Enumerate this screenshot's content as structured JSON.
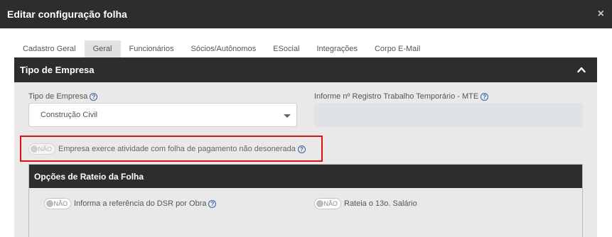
{
  "dialog": {
    "title": "Editar configuração folha",
    "close_glyph": "×"
  },
  "tabs": [
    {
      "label": "Cadastro Geral"
    },
    {
      "label": "Geral"
    },
    {
      "label": "Funcionários"
    },
    {
      "label": "Sócios/Autônomos"
    },
    {
      "label": "ESocial"
    },
    {
      "label": "Integrações"
    },
    {
      "label": "Corpo E-Mail"
    }
  ],
  "active_tab": "Geral",
  "section": {
    "title": "Tipo de Empresa",
    "tipo_empresa": {
      "label": "Tipo de Empresa",
      "value": "Construção Civil"
    },
    "registro": {
      "label": "Informe nº Registro Trabalho Temporário - MTE",
      "value": ""
    },
    "folha_toggle": {
      "state_label": "NÃO",
      "text": "Empresa exerce atividade com folha de pagamento não desonerada"
    },
    "rateio": {
      "title": "Opções de Rateio da Folha",
      "dsr": {
        "state_label": "NÃO",
        "text": "Informa a referência do DSR por Obra"
      },
      "salario13": {
        "state_label": "NÃO",
        "text": "Rateia o 13o. Salário"
      }
    }
  },
  "help_glyph": "?",
  "colors": {
    "header_bg": "#2d2d2d",
    "panel_bg": "#e9e9e9",
    "highlight_border": "#e01010",
    "help_blue": "#3a5fa0"
  }
}
